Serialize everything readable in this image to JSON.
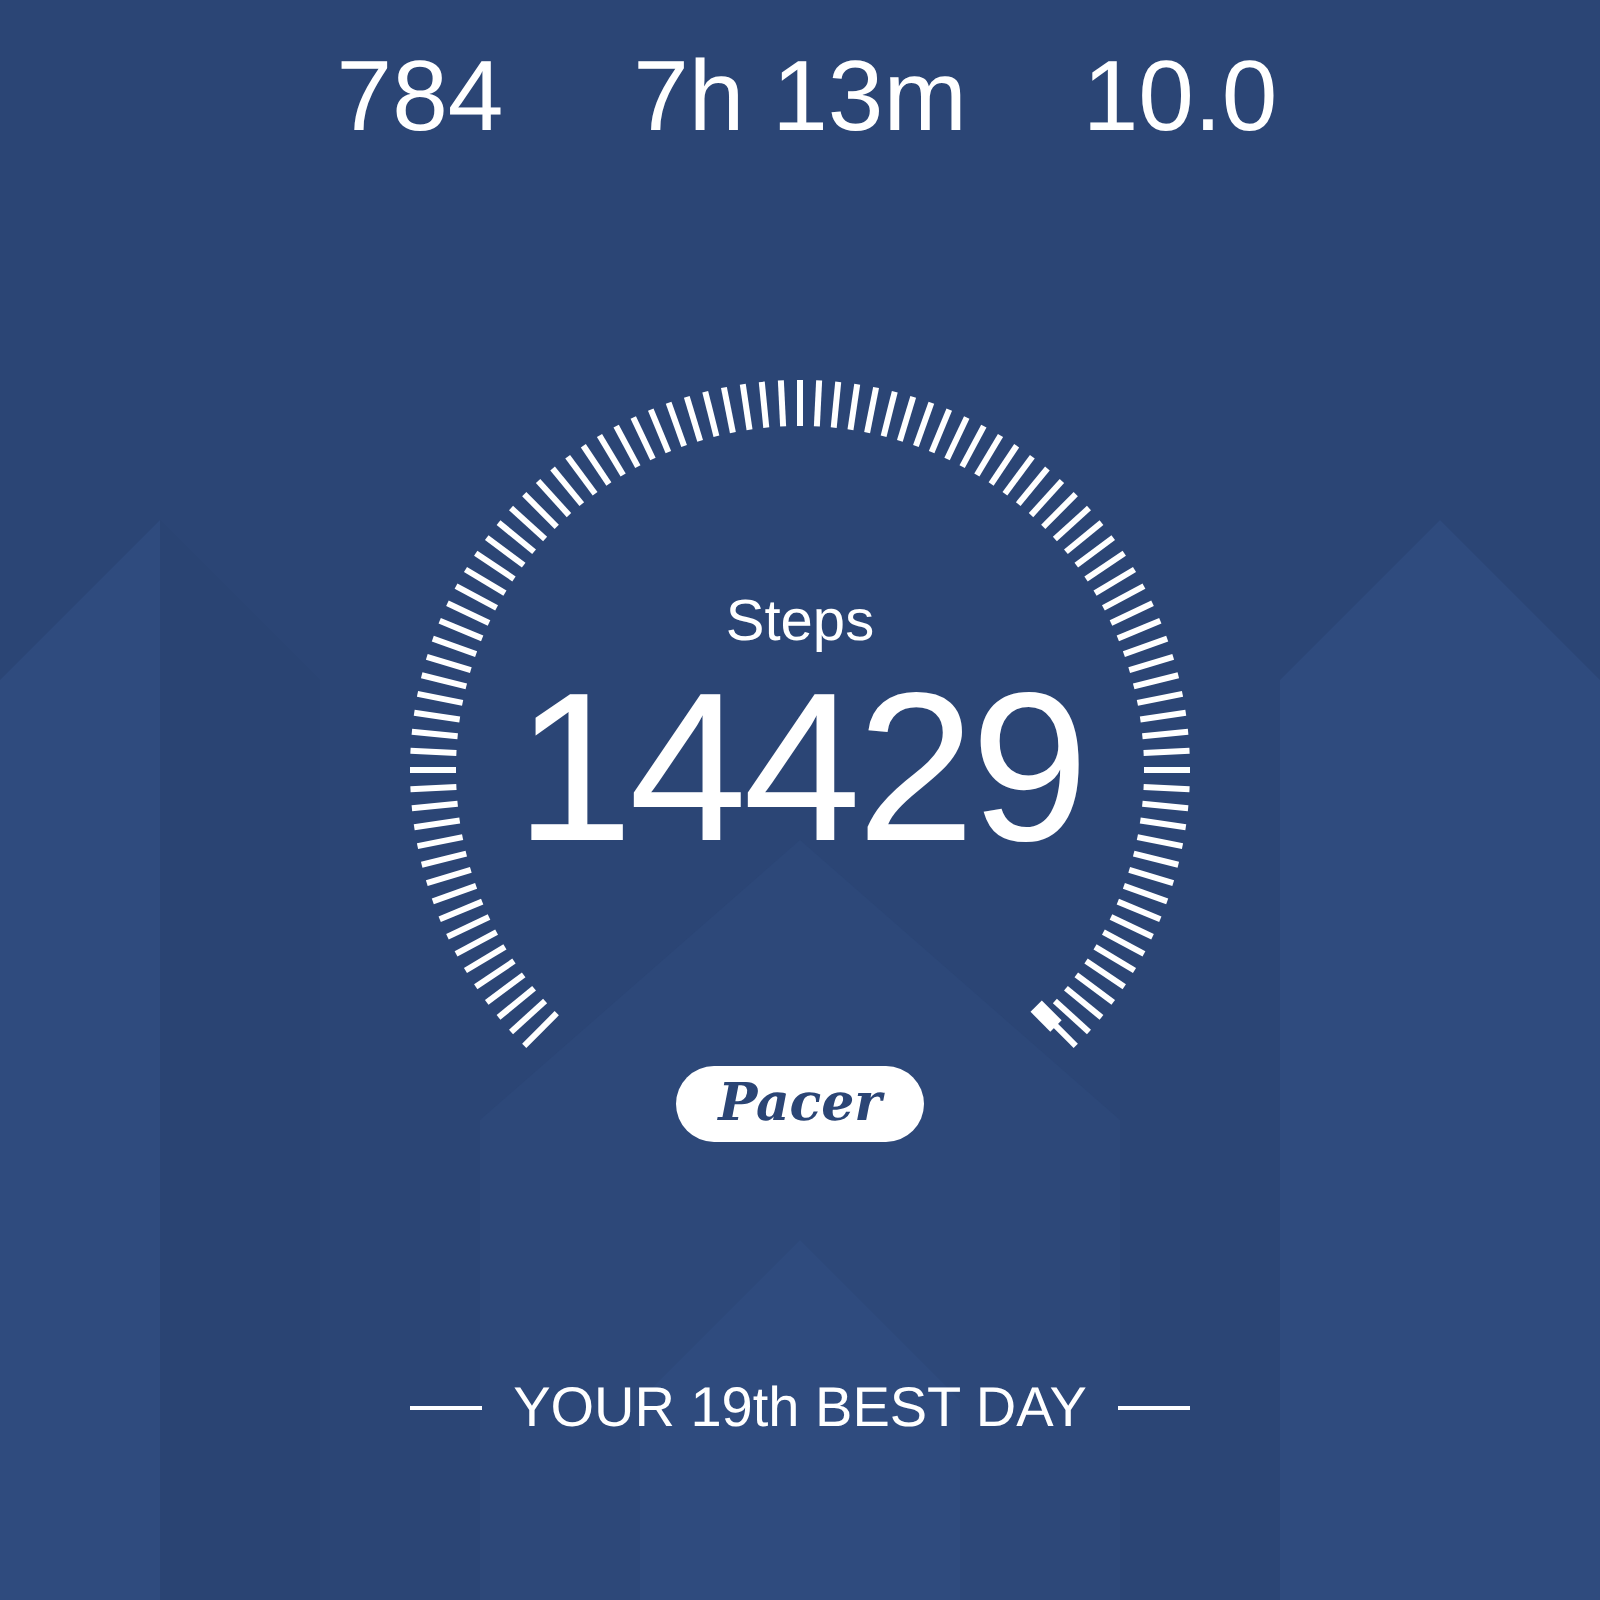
{
  "stats": [
    {
      "value": "784"
    },
    {
      "value": "7h 13m"
    },
    {
      "value": "10.0"
    }
  ],
  "gauge": {
    "label": "Steps",
    "value": "14429"
  },
  "logo": {
    "text": "Pacer"
  },
  "footer": {
    "text": "YOUR 19th BEST DAY"
  }
}
